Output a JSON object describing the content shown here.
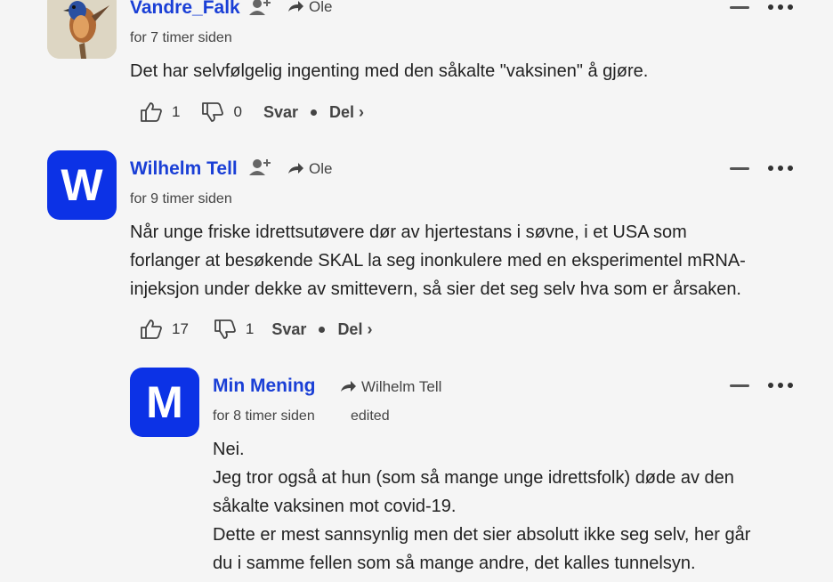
{
  "comments": [
    {
      "username": "Vandre_Falk",
      "reply_to": "Ole",
      "time": "for 7 timer siden",
      "lines": [
        "Det har selvfølgelig ingenting med den såkalte \"vaksinen\" å gjøre."
      ],
      "likes": "1",
      "dislikes": "0",
      "reply_label": "Svar",
      "share_label": "Del ›"
    },
    {
      "username": "Wilhelm Tell",
      "avatar_letter": "W",
      "reply_to": "Ole",
      "time": "for 9 timer siden",
      "lines": [
        "Når unge friske idrettsutøvere dør av hjertestans i søvne, i et USA som",
        "forlanger at besøkende SKAL la seg inonkulere med en eksperimentel mRNA-",
        "injeksjon under dekke av smittevern, så sier det seg selv hva som er årsaken."
      ],
      "likes": "17",
      "dislikes": "1",
      "reply_label": "Svar",
      "share_label": "Del ›"
    },
    {
      "username": "Min Mening",
      "avatar_letter": "M",
      "reply_to": "Wilhelm Tell",
      "time": "for 8 timer siden",
      "edited": "edited",
      "lines": [
        "Nei.",
        "Jeg tror også at hun (som så mange unge idrettsfolk) døde av den",
        "såkalte vaksinen mot covid-19.",
        "Dette er mest sannsynlig men det sier absolutt ikke seg selv, her går",
        "du i samme fellen som så mange andre, det kalles tunnelsyn."
      ]
    }
  ],
  "colors": {
    "avatar_blue": "#0c32e6",
    "username_blue": "#1a3fd6"
  },
  "icons": {
    "follow": "user-plus-icon",
    "reply_arrow": "reply-arrow-icon",
    "like": "thumbs-up-icon",
    "dislike": "thumbs-down-icon",
    "collapse": "minus-icon",
    "more": "more-horizontal-icon"
  }
}
